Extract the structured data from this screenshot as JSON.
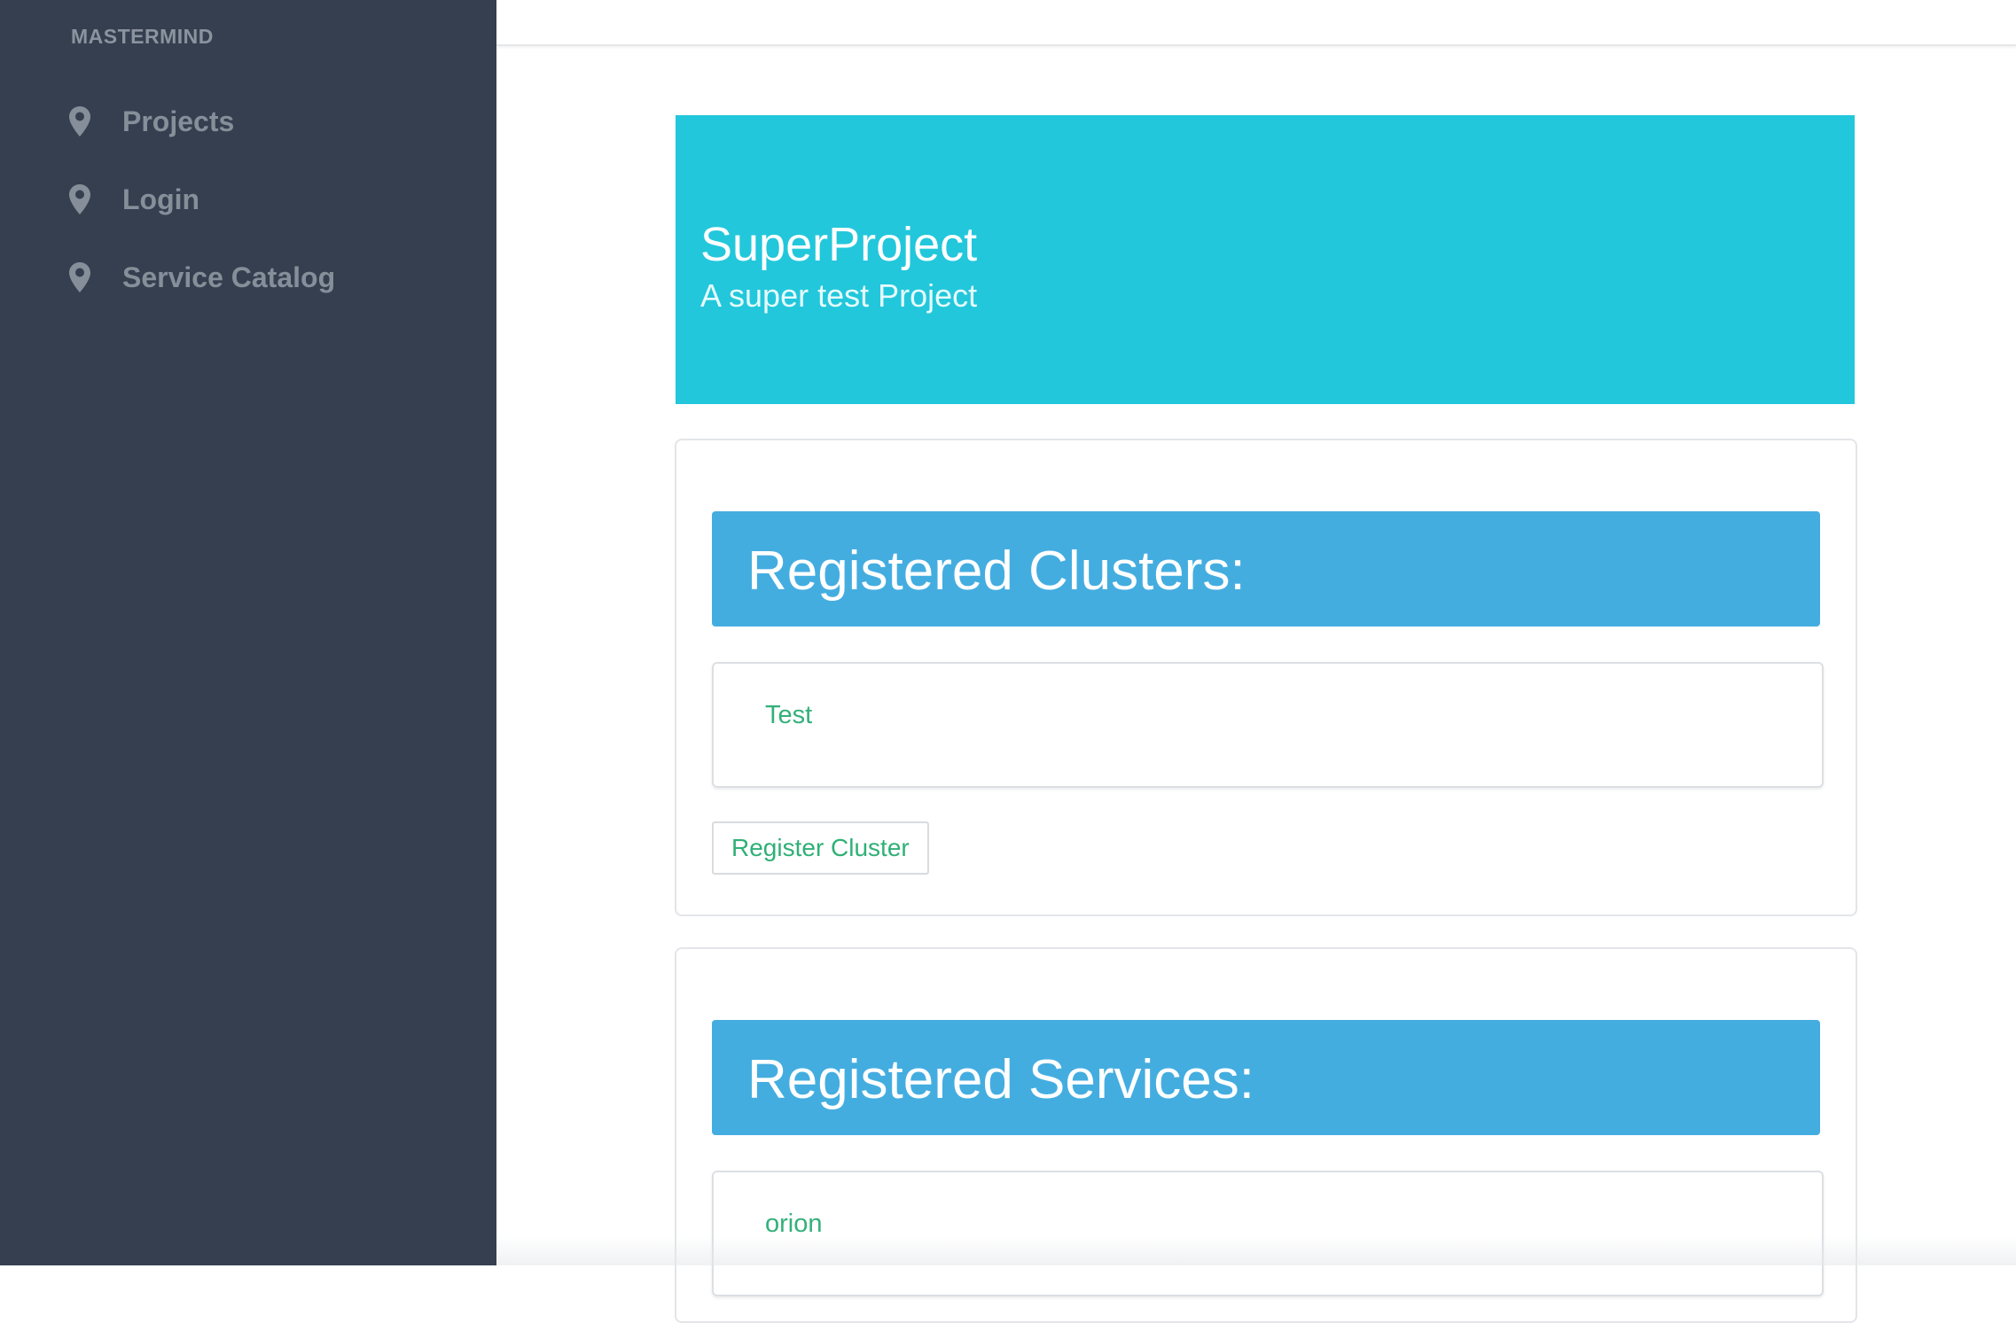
{
  "sidebar": {
    "brand": "MASTERMIND",
    "items": [
      {
        "label": "Projects",
        "icon": "map-pin-icon"
      },
      {
        "label": "Login",
        "icon": "map-pin-icon"
      },
      {
        "label": "Service Catalog",
        "icon": "map-pin-icon"
      }
    ]
  },
  "project": {
    "title": "SuperProject",
    "subtitle": "A super test Project"
  },
  "clusters": {
    "heading": "Registered Clusters:",
    "items": [
      "Test"
    ],
    "register_button": "Register Cluster"
  },
  "services": {
    "heading": "Registered Services:",
    "items": [
      "orion"
    ]
  },
  "colors": {
    "sidebar_bg": "#353f50",
    "hero_bg": "#22c7db",
    "section_header_bg": "#44ade0",
    "link_green": "#33b07a"
  }
}
